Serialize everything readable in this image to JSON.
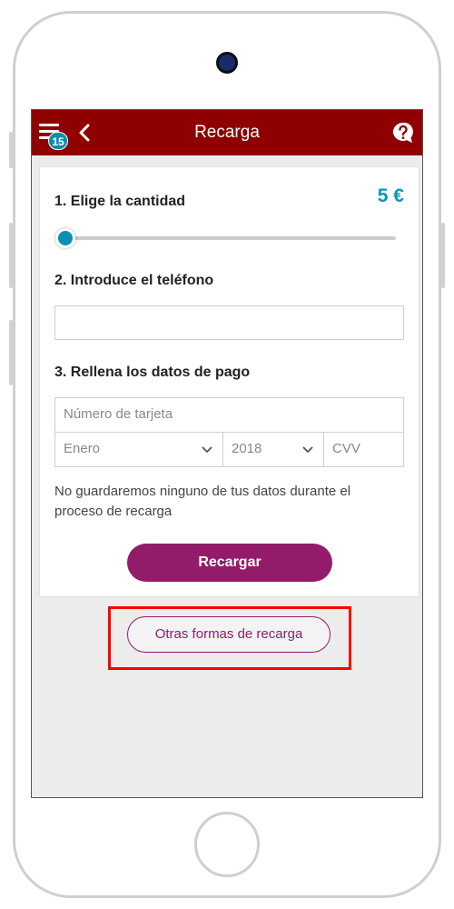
{
  "header": {
    "title": "Recarga",
    "notification_count": "15",
    "menu_icon": "menu-icon",
    "back_icon": "chevron-left-icon",
    "help_icon": "help-icon",
    "bar_color": "#8f0000"
  },
  "step1": {
    "label": "1. Elige la cantidad",
    "amount": "5 €",
    "slider_level": 0
  },
  "step2": {
    "label": "2. Introduce el teléfono",
    "phone_value": ""
  },
  "step3": {
    "label": "3. Rellena los datos de pago",
    "card_placeholder": "Número de tarjeta",
    "month_selected": "Enero",
    "year_selected": "2018",
    "cvv_placeholder": "CVV"
  },
  "note": "No guardaremos ninguno de tus datos durante el proceso de recarga",
  "recharge_button": "Recargar",
  "other_methods_button": "Otras formas de recarga",
  "colors": {
    "accent": "#0a95b8",
    "brand": "#921c6a",
    "highlight": "#ff0000"
  }
}
